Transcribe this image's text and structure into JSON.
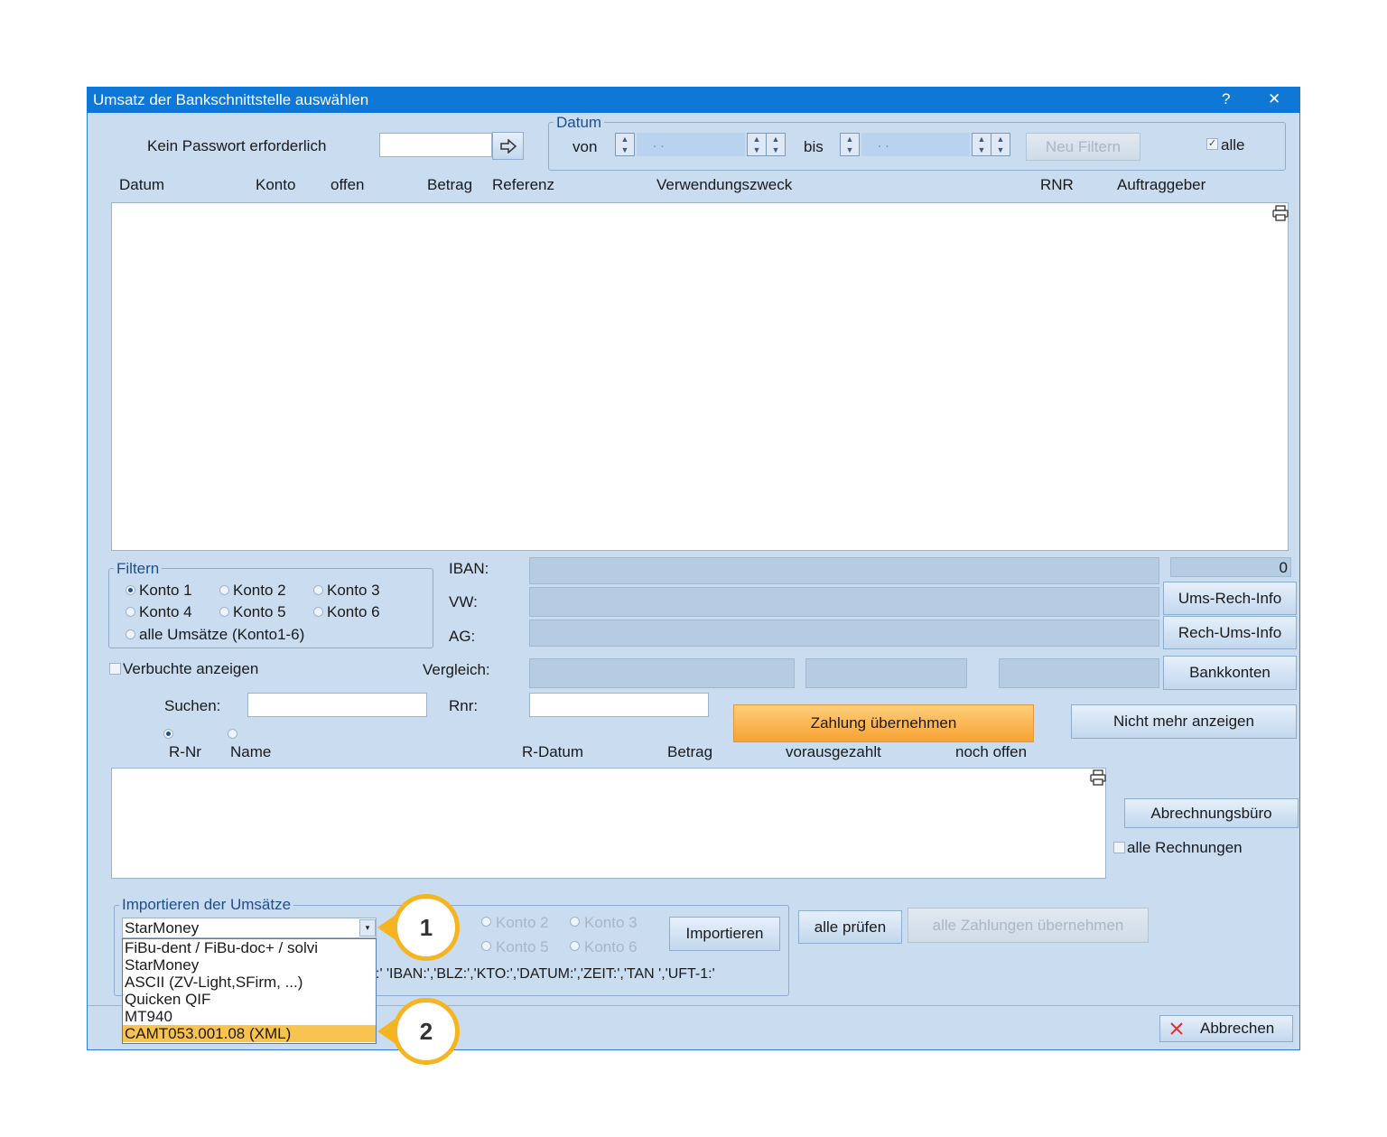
{
  "window": {
    "title": "Umsatz der Bankschnittstelle auswählen",
    "help": "?",
    "close": "✕"
  },
  "password": {
    "label": "Kein Passwort erforderlich",
    "value": ""
  },
  "datum": {
    "group_title": "Datum",
    "von_label": "von",
    "von_value": ".   .",
    "bis_label": "bis",
    "bis_value": ".   .",
    "filter_button": "Neu Filtern",
    "alle_label": "alle",
    "alle_checked": "✓"
  },
  "table_headers": [
    "Datum",
    "Konto",
    "offen",
    "Betrag",
    "Referenz",
    "Verwendungszweck",
    "RNR",
    "Auftraggeber"
  ],
  "filtern": {
    "title": "Filtern",
    "konto": [
      "Konto 1",
      "Konto 2",
      "Konto 3",
      "Konto 4",
      "Konto 5",
      "Konto 6"
    ],
    "alle": "alle Umsätze (Konto1-6)"
  },
  "info": {
    "iban_label": "IBAN:",
    "vw_label": "VW:",
    "ag_label": "AG:",
    "vergleich_label": "Vergleich:",
    "counter": "0",
    "ums_rech_info": "Ums-Rech-Info",
    "rech_ums_info": "Rech-Ums-Info",
    "bankkonten": "Bankkonten"
  },
  "verbuchte_label": "Verbuchte anzeigen",
  "suchen": {
    "label": "Suchen:",
    "value": "",
    "rnr_label": "Rnr:",
    "rnr_value": ""
  },
  "zahlung_button": "Zahlung übernehmen",
  "nicht_mehr_button": "Nicht mehr anzeigen",
  "invoice_headers": [
    "R-Nr",
    "Name",
    "R-Datum",
    "Betrag",
    "vorausgezahlt",
    "noch offen"
  ],
  "abrechnungsbuero": "Abrechnungsbüro",
  "alle_rechnungen": "alle Rechnungen",
  "import": {
    "title": "Importieren der Umsätze",
    "selected": "StarMoney",
    "options": [
      "FiBu-dent / FiBu-doc+ / solvi",
      "StarMoney",
      "ASCII (ZV-Light,SFirm, ...)",
      "Quicken QIF",
      "MT940",
      "CAMT053.001.08 (XML)"
    ],
    "konto": [
      "Konto 2",
      "Konto 3",
      "Konto 5",
      "Konto 6"
    ],
    "importieren": "Importieren",
    "keywords": ":' 'IBAN:','BLZ:','KTO:','DATUM:','ZEIT:','TAN ','UFT-1:'"
  },
  "alle_pruefen": "alle prüfen",
  "alle_zahlungen": "alle Zahlungen übernehmen",
  "abbrechen": "Abbrechen",
  "callouts": [
    "1",
    "2"
  ],
  "colors": {
    "titlebar": "#0f78d7",
    "window": "#c9dcf0",
    "accent": "#f5b523",
    "orange": "#f7a233"
  }
}
